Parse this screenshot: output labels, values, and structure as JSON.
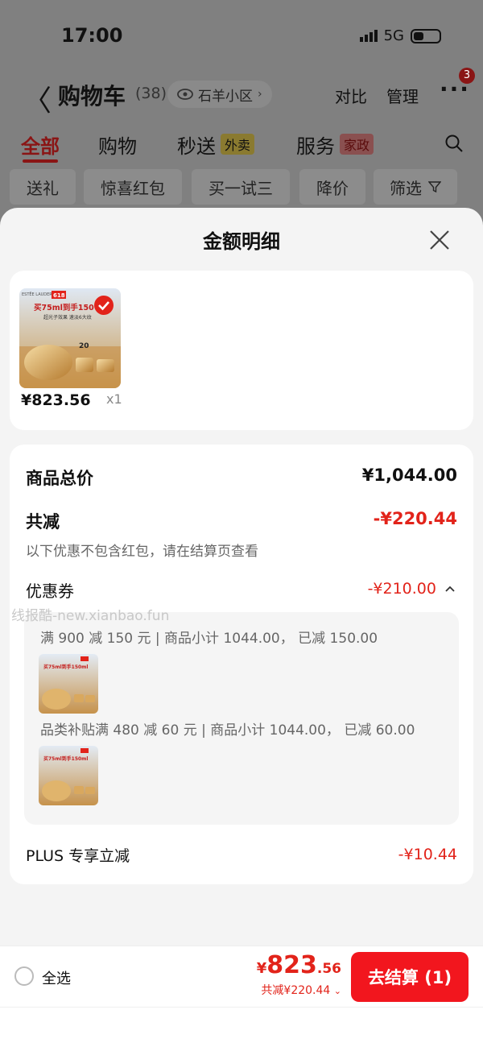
{
  "status": {
    "time": "17:00",
    "network": "5G"
  },
  "header": {
    "back": "〈",
    "title": "购物车",
    "count": "(38)",
    "location": "石羊小区",
    "compare": "对比",
    "manage": "管理",
    "more_badge": "3"
  },
  "tabs": [
    {
      "label": "全部",
      "active": true
    },
    {
      "label": "购物"
    },
    {
      "label": "秒送",
      "tag": "外卖"
    },
    {
      "label": "服务",
      "tag": "家政"
    }
  ],
  "chips": [
    "送礼",
    "惊喜红包",
    "买一试三",
    "降价",
    "筛选"
  ],
  "sheet": {
    "title": "金额明细",
    "product": {
      "price": "¥823.56",
      "qty": "x1",
      "image_text": {
        "brand": "ESTĒE LAUDER",
        "promo": "618",
        "headline": "买75ml到手150",
        "sub": "超光子效果 速淡6大纹",
        "badge": "20"
      }
    },
    "detail": {
      "total_label": "商品总价",
      "total_value": "¥1,044.00",
      "reduce_label": "共减",
      "reduce_value": "-¥220.44",
      "note": "以下优惠不包含红包，请在结算页查看",
      "coupon_label": "优惠券",
      "coupon_value": "-¥210.00",
      "coupons": [
        {
          "text": "满 900 减 150 元 | 商品小计 1044.00， 已减 150.00",
          "img_headline": "买75ml到手150ml"
        },
        {
          "text": "品类补贴满 480 减 60 元 | 商品小计 1044.00， 已减 60.00",
          "img_headline": "买75ml到手150ml"
        }
      ],
      "plus_label": "PLUS 专享立减",
      "plus_value": "-¥10.44"
    },
    "watermark": "线报酷-new.xianbao.fun"
  },
  "bottom": {
    "select_all": "全选",
    "currency": "¥",
    "total_int": "823",
    "total_dec": ".56",
    "saved": "共减¥220.44",
    "checkout": "去结算 (1)"
  },
  "colors": {
    "accent": "#e2231a",
    "checkout": "#f2161e",
    "sheet_bg": "#f4f4f4"
  }
}
